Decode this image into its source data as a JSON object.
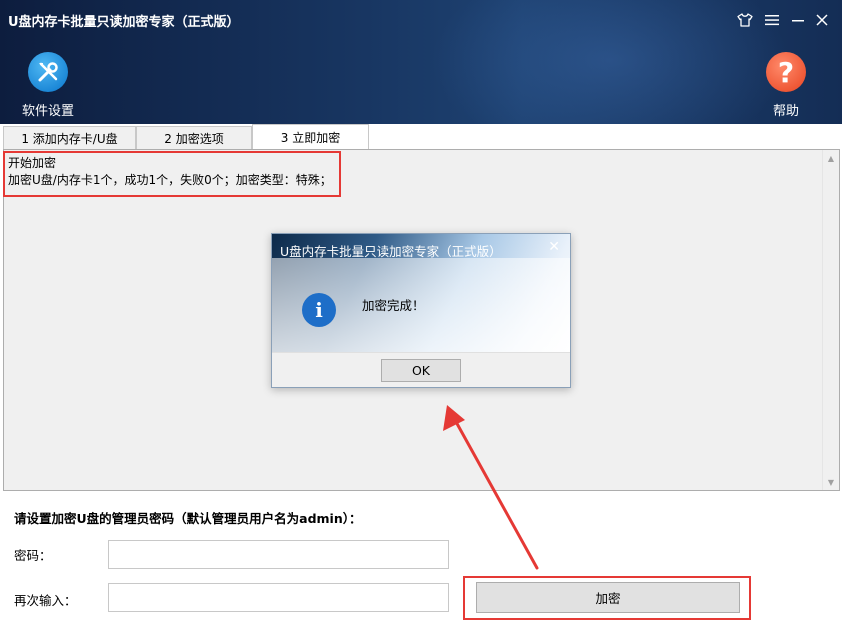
{
  "window": {
    "title": "U盘内存卡批量只读加密专家（正式版）",
    "controls": {
      "skin": "shirt-icon",
      "menu": "menu-icon",
      "minimize": "minimize-icon",
      "close": "close-icon"
    }
  },
  "toolbar": {
    "settings_label": "软件设置",
    "settings_icon": "tools-icon",
    "help_label": "帮助",
    "help_icon": "help-icon",
    "help_glyph": "?"
  },
  "tabs": [
    {
      "label": "1 添加内存卡/U盘",
      "active": false
    },
    {
      "label": "2 加密选项",
      "active": false
    },
    {
      "label": "3 立即加密",
      "active": true
    }
  ],
  "log": {
    "lines": [
      "开始加密",
      "加密U盘/内存卡1个，成功1个，失败0个；加密类型：特殊；"
    ]
  },
  "dialog": {
    "title": "U盘内存卡批量只读加密专家（正式版）",
    "close_glyph": "✕",
    "icon_glyph": "i",
    "message": "加密完成！",
    "ok_label": "OK"
  },
  "form": {
    "heading": "请设置加密U盘的管理员密码（默认管理员用户名为admin）：",
    "password_label": "密码：",
    "password_value": "",
    "confirm_label": "再次输入：",
    "confirm_value": "",
    "encrypt_button": "加密"
  },
  "colors": {
    "header_bg": "#17345f",
    "annotation_red": "#e53935",
    "settings_icon_bg": "#1a86d6",
    "help_icon_bg": "#ee5533",
    "info_icon_bg": "#1e6ec8"
  }
}
